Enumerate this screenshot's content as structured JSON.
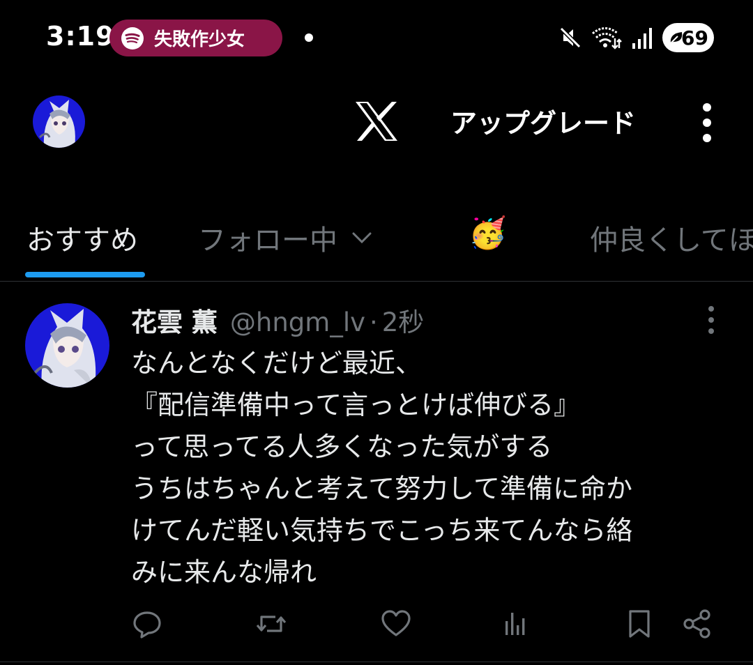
{
  "status_bar": {
    "time": "3:19",
    "media": {
      "app_icon": "spotify-icon",
      "title": "失敗作少女",
      "color": "#8a1547"
    },
    "icons": [
      "mute-icon",
      "wifi-icon",
      "signal-icon"
    ],
    "battery": "69"
  },
  "app_bar": {
    "logo": "X",
    "upgrade_label": "アップグレード",
    "menu_icon": "more-vertical-icon"
  },
  "tabs": [
    {
      "label": "おすすめ",
      "active": true
    },
    {
      "label": "フォロー中",
      "dropdown": true
    },
    {
      "label": "🥳"
    },
    {
      "label": "仲良くしてほ"
    }
  ],
  "post": {
    "display_name": "花雲 薫",
    "handle": "@hngm_lv",
    "separator": "·",
    "time": "2秒",
    "lines": [
      "なんとなくだけど最近、",
      "『配信準備中って言っとけば伸びる』",
      "って思ってる人多くなった気がする",
      "うちはちゃんと考えて努力して準備に命か",
      "けてんだ軽い気持ちでこっち来てんなら絡",
      "みに来んな帰れ"
    ],
    "actions": [
      "reply-icon",
      "repost-icon",
      "like-icon",
      "views-icon",
      "bookmark-icon",
      "share-icon"
    ]
  },
  "colors": {
    "accent": "#1d9bf0",
    "secondary_text": "#71767b",
    "divider": "#2f3336",
    "avatar_bg": "#1a1ad8"
  }
}
